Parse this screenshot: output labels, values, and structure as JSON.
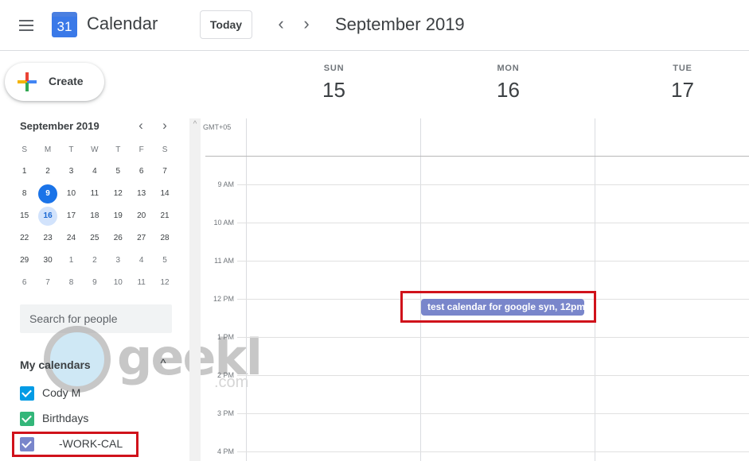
{
  "header": {
    "app_title": "Calendar",
    "logo_day": "31",
    "today_label": "Today",
    "period_title": "September 2019",
    "prev_icon": "‹",
    "next_icon": "›"
  },
  "sidebar": {
    "create_label": "Create",
    "mini_calendar": {
      "title": "September 2019",
      "prev_icon": "‹",
      "next_icon": "›",
      "weekdays": [
        "S",
        "M",
        "T",
        "W",
        "T",
        "F",
        "S"
      ],
      "today": 9,
      "selected": 16,
      "weeks": [
        [
          {
            "d": "1"
          },
          {
            "d": "2"
          },
          {
            "d": "3"
          },
          {
            "d": "4"
          },
          {
            "d": "5"
          },
          {
            "d": "6"
          },
          {
            "d": "7"
          }
        ],
        [
          {
            "d": "8"
          },
          {
            "d": "9",
            "state": "today"
          },
          {
            "d": "10"
          },
          {
            "d": "11"
          },
          {
            "d": "12"
          },
          {
            "d": "13"
          },
          {
            "d": "14"
          }
        ],
        [
          {
            "d": "15"
          },
          {
            "d": "16",
            "state": "selected"
          },
          {
            "d": "17"
          },
          {
            "d": "18"
          },
          {
            "d": "19"
          },
          {
            "d": "20"
          },
          {
            "d": "21"
          }
        ],
        [
          {
            "d": "22"
          },
          {
            "d": "23"
          },
          {
            "d": "24"
          },
          {
            "d": "25"
          },
          {
            "d": "26"
          },
          {
            "d": "27"
          },
          {
            "d": "28"
          }
        ],
        [
          {
            "d": "29"
          },
          {
            "d": "30"
          },
          {
            "d": "1",
            "other": true
          },
          {
            "d": "2",
            "other": true
          },
          {
            "d": "3",
            "other": true
          },
          {
            "d": "4",
            "other": true
          },
          {
            "d": "5",
            "other": true
          }
        ],
        [
          {
            "d": "6",
            "other": true
          },
          {
            "d": "7",
            "other": true
          },
          {
            "d": "8",
            "other": true
          },
          {
            "d": "9",
            "other": true
          },
          {
            "d": "10",
            "other": true
          },
          {
            "d": "11",
            "other": true
          },
          {
            "d": "12",
            "other": true
          }
        ]
      ]
    },
    "search_people_placeholder": "Search for people",
    "my_calendars": {
      "heading": "My calendars",
      "collapse_icon": "^",
      "items": [
        {
          "label": "Cody M",
          "checked": true,
          "color": "#039be5"
        },
        {
          "label": "Birthdays",
          "checked": true,
          "color": "#33b679"
        },
        {
          "label": "-WORK-CAL",
          "checked": true,
          "color": "#7986cb"
        }
      ]
    }
  },
  "watermark": {
    "text": "geekl",
    "suffix": ".com"
  },
  "main": {
    "timezone": "GMT+05",
    "scroll_up_icon": "^",
    "days": [
      {
        "name": "SUN",
        "num": "15"
      },
      {
        "name": "MON",
        "num": "16"
      },
      {
        "name": "TUE",
        "num": "17"
      }
    ],
    "hours": [
      "9 AM",
      "10 AM",
      "11 AM",
      "12 PM",
      "1 PM",
      "2 PM",
      "3 PM",
      "4 PM"
    ],
    "event": {
      "title": "test calendar for google syn, 12pm",
      "day": "MON",
      "time": "12 PM",
      "color": "#7986cb"
    }
  },
  "annotations": {
    "highlight_color": "#d0121b"
  }
}
